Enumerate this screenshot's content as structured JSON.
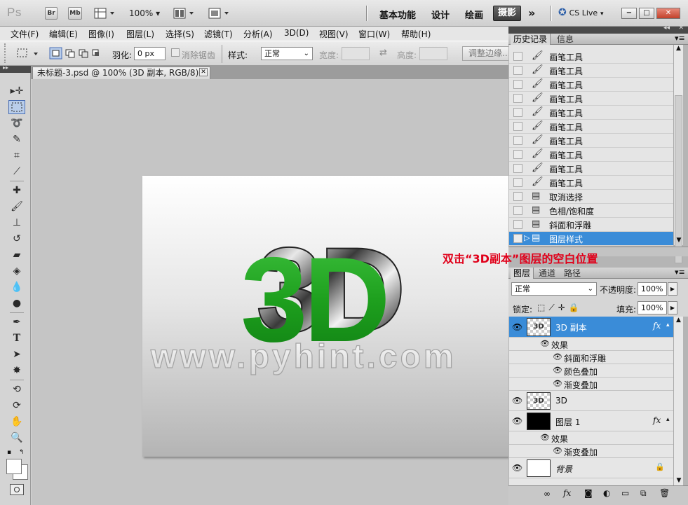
{
  "app": {
    "logo": "Ps",
    "br": "Br",
    "mb": "Mb",
    "zoom": "100%",
    "workspaces": [
      "基本功能",
      "设计",
      "绘画",
      "摄影"
    ],
    "more": "»",
    "cslive": "CS Live",
    "win_min": "−",
    "win_max": "□",
    "win_close": "✕"
  },
  "menu": [
    "文件(F)",
    "编辑(E)",
    "图像(I)",
    "图层(L)",
    "选择(S)",
    "滤镜(T)",
    "分析(A)",
    "3D(D)",
    "视图(V)",
    "窗口(W)",
    "帮助(H)"
  ],
  "options": {
    "feather_label": "羽化:",
    "feather_value": "0 px",
    "antialias": "消除锯齿",
    "style_label": "样式:",
    "style_value": "正常",
    "width_label": "宽度:",
    "height_label": "高度:",
    "refine": "调整边缘..."
  },
  "document": {
    "tab_title": "未标题-3.psd @ 100% (3D 副本, RGB/8) *",
    "art_text": "3D",
    "watermark": "www.pyhint.com"
  },
  "history": {
    "tabs": [
      "历史记录",
      "信息"
    ],
    "items": [
      {
        "label": "画笔工具",
        "icon": "brush-icon"
      },
      {
        "label": "画笔工具",
        "icon": "brush-icon"
      },
      {
        "label": "画笔工具",
        "icon": "brush-icon"
      },
      {
        "label": "画笔工具",
        "icon": "brush-icon"
      },
      {
        "label": "画笔工具",
        "icon": "brush-icon"
      },
      {
        "label": "画笔工具",
        "icon": "brush-icon"
      },
      {
        "label": "画笔工具",
        "icon": "brush-icon"
      },
      {
        "label": "画笔工具",
        "icon": "brush-icon"
      },
      {
        "label": "画笔工具",
        "icon": "brush-icon"
      },
      {
        "label": "画笔工具",
        "icon": "brush-icon"
      },
      {
        "label": "取消选择",
        "icon": "document-icon"
      },
      {
        "label": "色相/饱和度",
        "icon": "document-icon"
      },
      {
        "label": "斜面和浮雕",
        "icon": "document-icon"
      },
      {
        "label": "图层样式",
        "icon": "document-icon",
        "selected": true
      }
    ]
  },
  "annotation": "双击“3D副本”图层的空白位置",
  "layers": {
    "tabs": [
      "图层",
      "通道",
      "路径"
    ],
    "blend_mode": "正常",
    "opacity_label": "不透明度:",
    "opacity_value": "100%",
    "lock_label": "锁定:",
    "fill_label": "填充:",
    "fill_value": "100%",
    "fx": "fx",
    "thumb_3d": "3D",
    "layer_3d_copy": "3D 副本",
    "effects_label": "效果",
    "effect_bevel": "斜面和浮雕",
    "effect_color": "颜色叠加",
    "effect_gradient": "渐变叠加",
    "layer_3d": "3D",
    "layer_1": "图层 1",
    "effects_label_2": "效果",
    "effect_gradient_2": "渐变叠加",
    "background": "背景"
  },
  "colors": {
    "selection": "#3a8cd8",
    "annotation": "#e0001a",
    "text_green": "#1ea01e"
  }
}
